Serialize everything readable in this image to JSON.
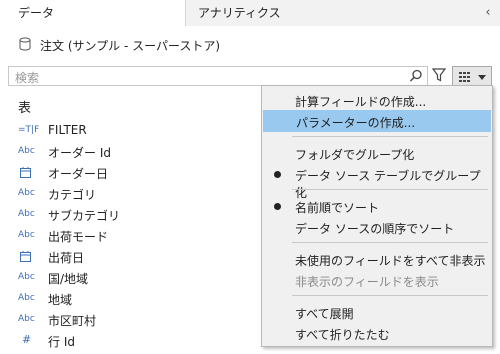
{
  "tabs": {
    "data_label": "データ",
    "analytics_label": "アナリティクス",
    "collapse_icon": "chevron-left-icon"
  },
  "datasource": {
    "name": "注文 (サンプル - スーパーストア)"
  },
  "search": {
    "placeholder": "検索"
  },
  "fields": {
    "section_title": "表",
    "items": [
      {
        "icon": "=T|F",
        "name": "FILTER"
      },
      {
        "icon": "Abc",
        "name": "オーダー Id"
      },
      {
        "icon": "date",
        "name": "オーダー日"
      },
      {
        "icon": "Abc",
        "name": "カテゴリ"
      },
      {
        "icon": "Abc",
        "name": "サブカテゴリ"
      },
      {
        "icon": "Abc",
        "name": "出荷モード"
      },
      {
        "icon": "date",
        "name": "出荷日"
      },
      {
        "icon": "Abc",
        "name": "国/地域"
      },
      {
        "icon": "Abc",
        "name": "地域"
      },
      {
        "icon": "Abc",
        "name": "市区町村"
      },
      {
        "icon": "#",
        "name": "行 Id"
      }
    ]
  },
  "menu": {
    "create_calc": "計算フィールドの作成...",
    "create_param": "パラメーターの作成...",
    "group_by_folder": "フォルダでグループ化",
    "group_by_table": "データ ソース テーブルでグループ化",
    "sort_by_name": "名前順でソート",
    "sort_by_ds_order": "データ ソースの順序でソート",
    "hide_unused": "未使用のフィールドをすべて非表示",
    "show_hidden": "非表示のフィールドを表示",
    "expand_all": "すべて展開",
    "collapse_all": "すべて折りたたむ"
  },
  "colors": {
    "highlight": "#99c9ef",
    "icon_blue": "#3b6fb6"
  }
}
